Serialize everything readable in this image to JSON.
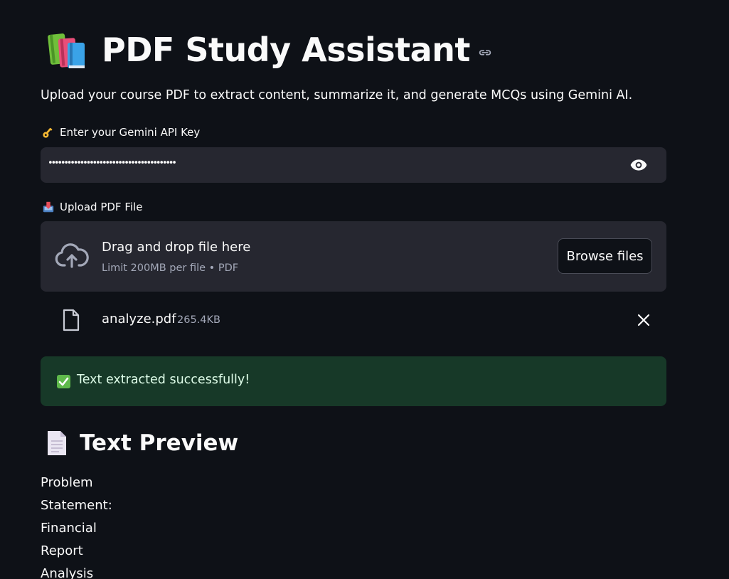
{
  "header": {
    "title": "PDF Study Assistant",
    "description": "Upload your course PDF to extract content, summarize it, and generate MCQs using Gemini AI."
  },
  "api_key": {
    "label": "Enter your Gemini API Key",
    "value_masked": "••••••••••••••••••••••••••••••••••••••••"
  },
  "upload": {
    "label": "Upload PDF File",
    "dropzone_title": "Drag and drop file here",
    "dropzone_subtitle": "Limit 200MB per file • PDF",
    "browse_label": "Browse files"
  },
  "uploaded_file": {
    "name": "analyze.pdf",
    "size": "265.4KB"
  },
  "status": {
    "message": "Text extracted successfully!",
    "color": "#173928"
  },
  "preview": {
    "heading": "Text Preview",
    "lines": [
      "Problem",
      "Statement:",
      "Financial",
      "Report",
      "Analysis"
    ]
  },
  "icons": {
    "title": "books-icon",
    "api": "key-icon",
    "upload": "inbox-tray-icon",
    "success": "check-mark-icon",
    "preview": "page-icon"
  }
}
